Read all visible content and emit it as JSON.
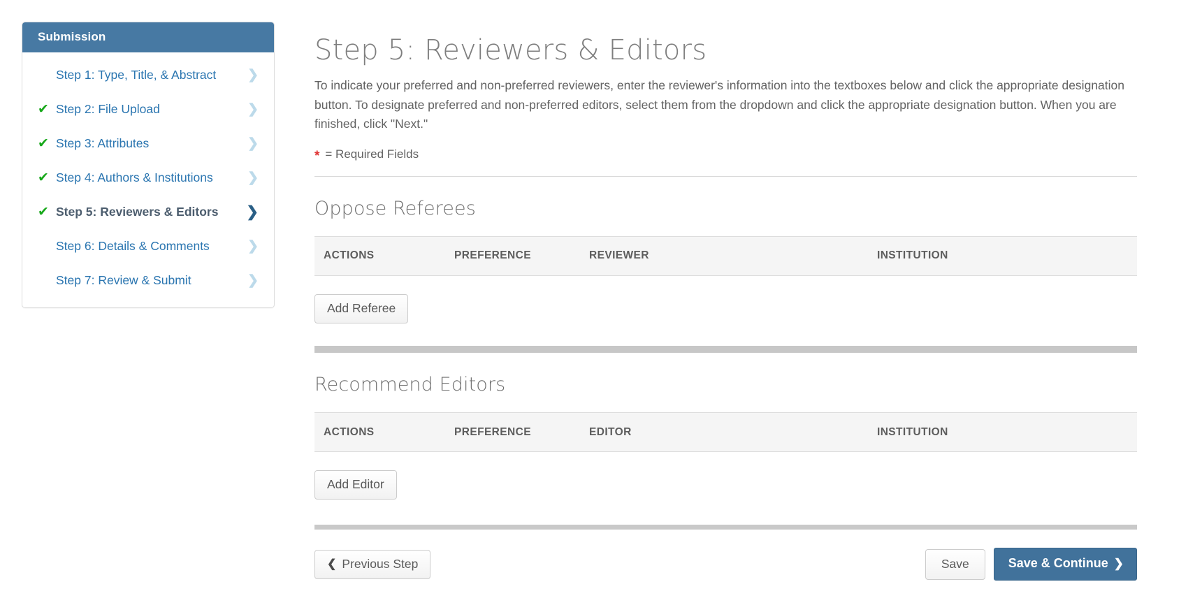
{
  "sidebar": {
    "header": "Submission",
    "items": [
      {
        "label": "Step 1: Type, Title, & Abstract",
        "check": "",
        "active": false
      },
      {
        "label": "Step 2: File Upload",
        "check": "✔",
        "active": false
      },
      {
        "label": "Step 3: Attributes",
        "check": "✔",
        "active": false
      },
      {
        "label": "Step 4: Authors & Institutions",
        "check": "✔",
        "active": false
      },
      {
        "label": "Step 5: Reviewers & Editors",
        "check": "✔",
        "active": true
      },
      {
        "label": "Step 6: Details & Comments",
        "check": "",
        "active": false
      },
      {
        "label": "Step 7: Review & Submit",
        "check": "",
        "active": false
      }
    ],
    "chevron": "❯"
  },
  "main": {
    "title": "Step 5: Reviewers & Editors",
    "intro": "To indicate your preferred and non-preferred reviewers, enter the reviewer's information into the textboxes below and click the appropriate designation button. To designate preferred and non-preferred editors, select them from the dropdown and click the appropriate designation button. When you are finished, click \"Next.\"",
    "required_star": "*",
    "required_label": "= Required Fields"
  },
  "referees": {
    "section_title": "Oppose Referees",
    "columns": [
      "ACTIONS",
      "PREFERENCE",
      "REVIEWER",
      "INSTITUTION"
    ],
    "rows": [],
    "add_button": "Add Referee"
  },
  "editors": {
    "section_title": "Recommend Editors",
    "columns": [
      "ACTIONS",
      "PREFERENCE",
      "EDITOR",
      "INSTITUTION"
    ],
    "rows": [],
    "add_button": "Add Editor"
  },
  "footer": {
    "previous_label": "Previous Step",
    "previous_chevron": "❮",
    "save_label": "Save",
    "save_continue_label": "Save & Continue",
    "save_continue_chevron": "❯"
  },
  "colors": {
    "brand_blue": "#4779a3",
    "primary_button": "#41729b",
    "link_blue": "#2a75b0",
    "check_green": "#17a81a",
    "required_red": "#e03434",
    "header_row": "#f5f5f5",
    "thick_rule": "#c7c7c7"
  }
}
